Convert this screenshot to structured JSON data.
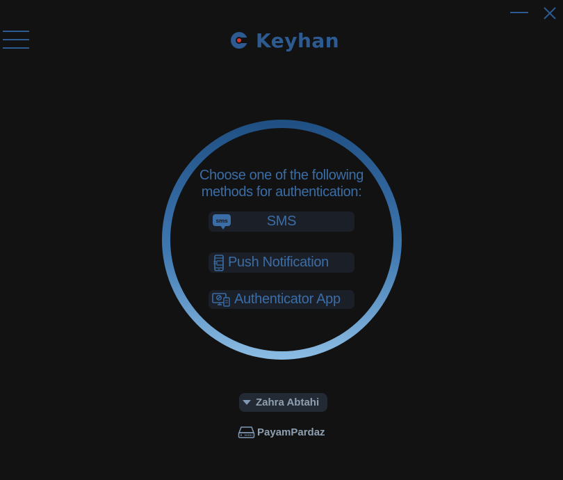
{
  "window": {
    "minimize_icon": "minimize-icon",
    "close_icon": "close-icon"
  },
  "header": {
    "menu_icon": "hamburger-menu-icon",
    "logo_icon": "keyhan-logo-icon",
    "app_name": "Keyhan"
  },
  "auth": {
    "prompt_line1": "Choose one of the following",
    "prompt_line2": "methods for authentication:",
    "methods": [
      {
        "label": "SMS",
        "icon": "sms-icon"
      },
      {
        "label": "Push Notification",
        "icon": "mobile-phone-icon"
      },
      {
        "label": "Authenticator App",
        "icon": "authenticator-devices-icon"
      }
    ]
  },
  "user": {
    "name": "Zahra Abtahi",
    "dropdown_icon": "caret-down-icon"
  },
  "company": {
    "name": "PayamPardaz",
    "icon": "server-device-icon"
  },
  "colors": {
    "background": "#121212",
    "accent": "#2c5a91",
    "text_blue": "#3b6da6",
    "ring_top": "#1f4f83",
    "ring_bottom": "#8cbde4",
    "logo_red": "#d8322e",
    "muted_text": "#8e9fb1"
  }
}
